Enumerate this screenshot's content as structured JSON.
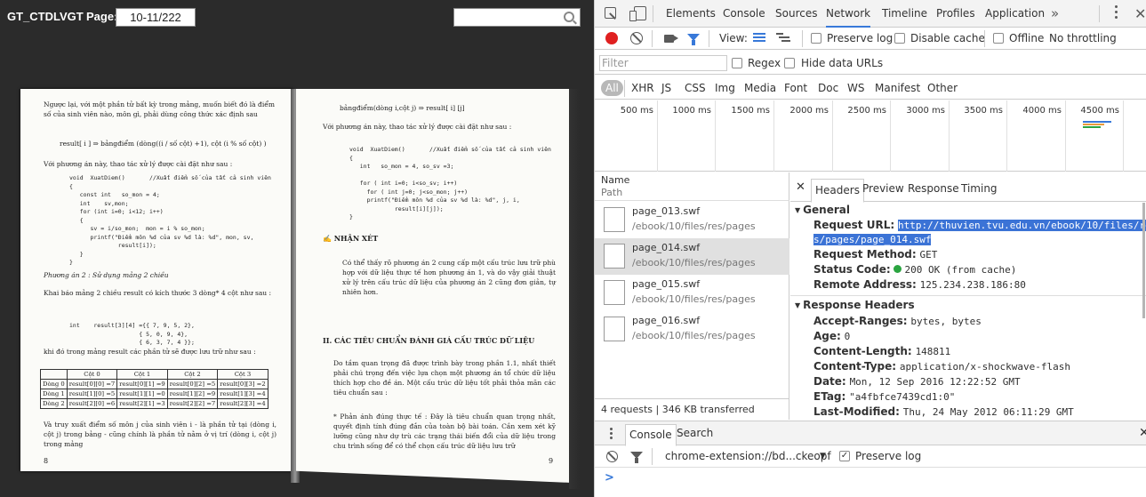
{
  "viewer": {
    "title": "GT_CTDLVGT",
    "page_label": "Page:",
    "page_value": "10-11/222",
    "left_page": {
      "para1": "Ngược lại, với một phần tử bất kỳ trong mảng, muốn biết đó là điểm số của sinh viên nào, môn gì, phải dùng công thức xác định sau",
      "formula1": "result[ i ]  ⇒  bảngđiểm (dòng((i / số cột) +1), cột (i % số cột) )",
      "para2": "Với phương án này, thao tác xử lý được cài đặt như sau :",
      "code1": "void  XuatDiem()       //Xuất điểm số của tất cả sinh viên\n{\n   const int   so_mon = 4;\n   int    sv,mon;\n   for (int i=0; i<12; i++)\n   {\n      sv = i/so_mon;  mon = i % so_mon;\n      printf(\"Điểm môn %d của sv %d là: %d\", mon, sv,\n              result[i]);\n   }\n}",
      "heading2": "Phương án 2 : Sử dụng mảng 2 chiều",
      "para3": "Khai báo mảng 2 chiều result có kích thước 3 dòng* 4 cột như sau :",
      "code2": "int    result[3][4] ={{ 7, 9, 5, 2},\n                    { 5, 0, 9, 4},\n                    { 6, 3, 7, 4 }};",
      "para4": "khi đó trong mảng result  các phần tử sẽ được lưu trữ như sau :",
      "table_header": [
        "",
        "Cột 0",
        "Cột 1",
        "Cột 2",
        "Cột 3"
      ],
      "table_rows": [
        [
          "Dòng 0",
          "result[0][0] =7",
          "result[0][1] =9",
          "result[0][2] =5",
          "result[0][3] =2"
        ],
        [
          "Dòng 1",
          "result[1][0] =5",
          "result[1][1] =0",
          "result[1][2] =9",
          "result[1][3] =4"
        ],
        [
          "Dòng 2",
          "result[2][0] =6",
          "result[2][1] =3",
          "result[2][2] =7",
          "result[2][3] =4"
        ]
      ],
      "para5": "Và truy xuất  điểm số môn j của sinh viên i - là phần tử tại (dòng i, cột j) trong bảng - cũng chính là phần tử nằm ở vị trí (dòng i, cột j) trong mảng",
      "page_no": "8"
    },
    "right_page": {
      "line1": "bảngđiểm(dòng i,cột j)   ⇒   result[ i] [j]",
      "para1": "Với phương án này, thao tác xử lý được cài đặt như sau :",
      "code1": "void  XuatDiem()       //Xuất điểm số của tất cả sinh viên\n{\n   int   so_mon = 4, so_sv =3;\n\n   for ( int i=0; i<so_sv; i++)\n     for ( int j=0; j<so_mon; j++)\n     printf(\"Điểm môn %d của sv %d là: %d\", j, i,\n             result[i][j]);\n}",
      "heading1": "✍ NHẬN XÉT",
      "para2": "Có thể thấy rõ phương án 2 cung cấp một cấu trúc lưu trữ phù hợp với dữ liệu thực tế hơn phương án 1, và do vậy giải thuật xử lý trên cấu trúc dữ liệu của phương án 2 cũng đơn giản, tự nhiên hơn.",
      "heading2": "II.  CÁC TIÊU CHUẨN ĐÁNH GIÁ CẤU TRÚC DỮ LIỆU",
      "para3": "Do tầm quan trọng đã được trình bày trong phần 1.1, nhất thiết phải chú trọng đến việc lựa chọn một phương án tổ chức dữ liệu thích hợp cho đề án. Một cấu trúc dữ liệu tốt phải thỏa mãn các tiêu chuẩn sau :",
      "para4": "* Phản ánh đúng thực tế : Đây là tiêu chuẩn quan trọng nhất, quyết định tính đúng đắn của toàn bộ bài toán. Cần xem xét kỹ lưỡng cũng như dự trù các trạng thái biến đổi của dữ liệu trong chu trình sống để có thể chọn cấu trúc dữ liệu lưu trữ",
      "page_no": "9"
    }
  },
  "devtools": {
    "tabs": [
      "Elements",
      "Console",
      "Sources",
      "Network",
      "Timeline",
      "Profiles",
      "Application"
    ],
    "active_tab": "Network",
    "more": "»",
    "toolbar": {
      "view_label": "View:",
      "preserve_log": "Preserve log",
      "disable_cache": "Disable cache",
      "offline": "Offline",
      "throttling": "No throttling"
    },
    "filter": {
      "placeholder": "Filter",
      "regex": "Regex",
      "hide_data_urls": "Hide data URLs"
    },
    "types": [
      "All",
      "XHR",
      "JS",
      "CSS",
      "Img",
      "Media",
      "Font",
      "Doc",
      "WS",
      "Manifest",
      "Other"
    ],
    "timeline_ticks": [
      "500 ms",
      "1000 ms",
      "1500 ms",
      "2000 ms",
      "2500 ms",
      "3000 ms",
      "3500 ms",
      "4000 ms",
      "4500 ms"
    ],
    "list_header": {
      "name": "Name",
      "path": "Path"
    },
    "requests": [
      {
        "name": "page_013.swf",
        "path": "/ebook/10/files/res/pages"
      },
      {
        "name": "page_014.swf",
        "path": "/ebook/10/files/res/pages"
      },
      {
        "name": "page_015.swf",
        "path": "/ebook/10/files/res/pages"
      },
      {
        "name": "page_016.swf",
        "path": "/ebook/10/files/res/pages"
      }
    ],
    "footer": "4 requests  |  346 KB transferred",
    "detail_tabs": [
      "Headers",
      "Preview",
      "Response",
      "Timing"
    ],
    "general": {
      "title": "General",
      "request_url_label": "Request URL:",
      "request_url_1": "http://thuvien.tvu.edu.vn/ebook/10/files/re",
      "request_url_2": "s/pages/page_014.swf",
      "request_method_label": "Request Method:",
      "request_method": "GET",
      "status_code_label": "Status Code:",
      "status_code": "200 OK (from cache)",
      "remote_address_label": "Remote Address:",
      "remote_address": "125.234.238.186:80"
    },
    "response_headers": {
      "title": "Response Headers",
      "items": [
        {
          "k": "Accept-Ranges:",
          "v": "bytes, bytes"
        },
        {
          "k": "Age:",
          "v": "0"
        },
        {
          "k": "Content-Length:",
          "v": "148811"
        },
        {
          "k": "Content-Type:",
          "v": "application/x-shockwave-flash"
        },
        {
          "k": "Date:",
          "v": "Mon, 12 Sep 2016 12:22:52 GMT"
        },
        {
          "k": "ETag:",
          "v": "\"a4fbfce7439cd1:0\""
        },
        {
          "k": "Last-Modified:",
          "v": "Thu, 24 May 2012 06:11:29 GMT"
        }
      ]
    },
    "drawer": {
      "tabs": [
        "Console",
        "Search"
      ],
      "context": "chrome-extension://bd...ckeopf",
      "caret": "▼",
      "preserve_log": "Preserve log",
      "check": "✓",
      "prompt": ">"
    }
  }
}
